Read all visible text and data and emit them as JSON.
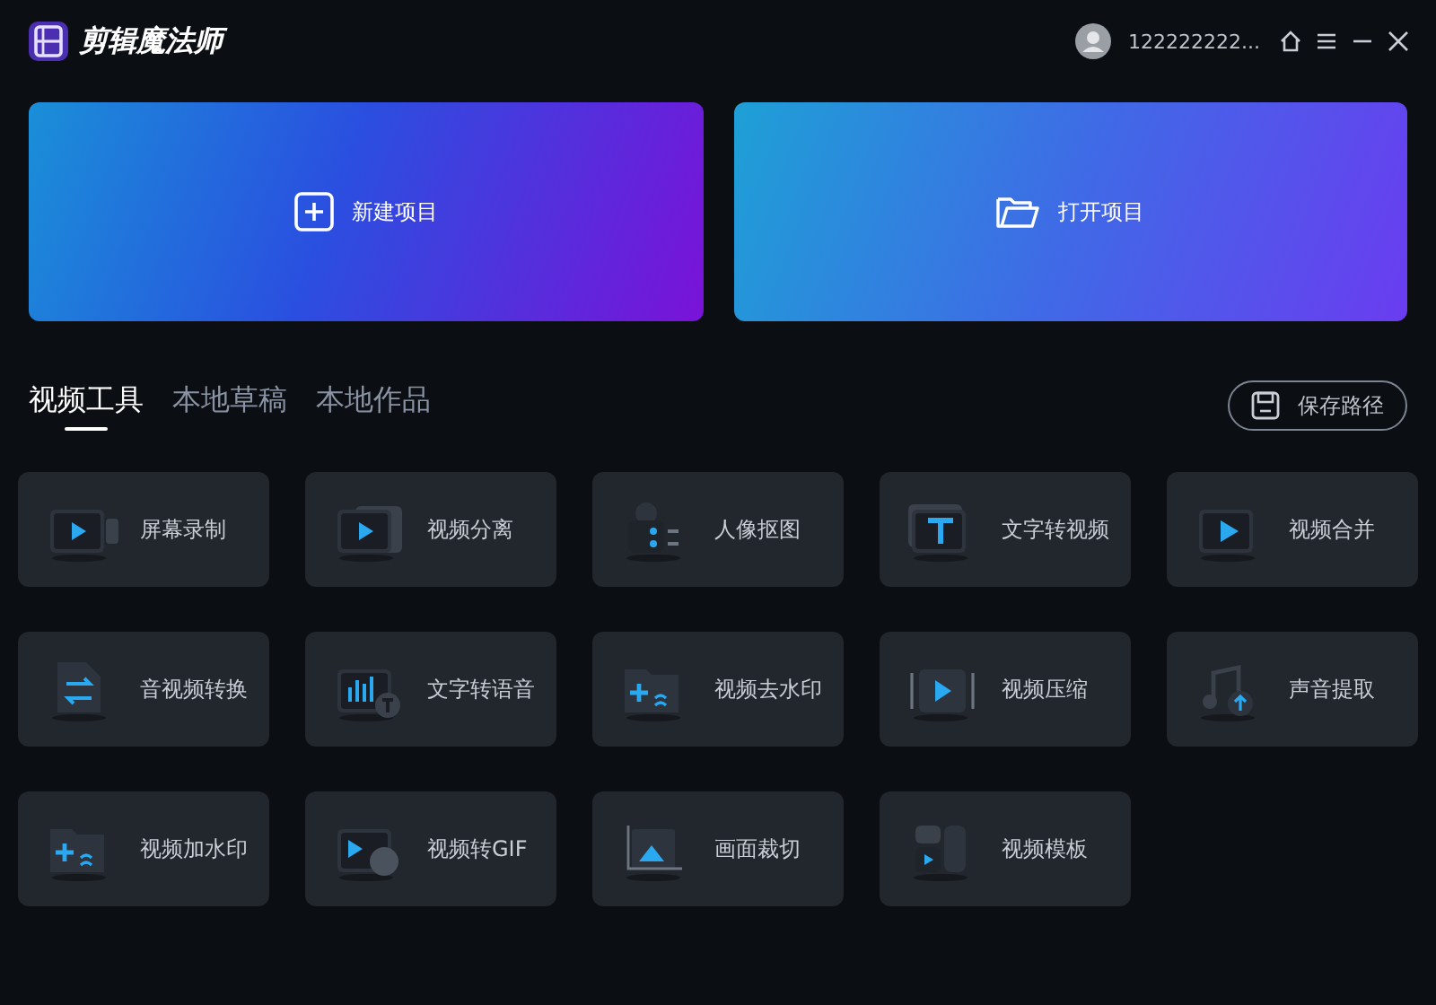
{
  "app": {
    "title": "剪辑魔法师"
  },
  "user": {
    "name": "122222222..."
  },
  "actions": [
    {
      "label": "新建项目",
      "kind": "new"
    },
    {
      "label": "打开项目",
      "kind": "open"
    }
  ],
  "tabs": [
    {
      "label": "视频工具",
      "selected": true
    },
    {
      "label": "本地草稿",
      "selected": false
    },
    {
      "label": "本地作品",
      "selected": false
    }
  ],
  "save_path_button": {
    "label": "保存路径"
  },
  "tools": [
    {
      "label": "屏幕录制"
    },
    {
      "label": "视频分离"
    },
    {
      "label": "人像抠图"
    },
    {
      "label": "文字转视频"
    },
    {
      "label": "视频合并"
    },
    {
      "label": "音视频转换"
    },
    {
      "label": "文字转语音"
    },
    {
      "label": "视频去水印"
    },
    {
      "label": "视频压缩"
    },
    {
      "label": "声音提取"
    },
    {
      "label": "视频加水印"
    },
    {
      "label": "视频转GIF"
    },
    {
      "label": "画面裁切"
    },
    {
      "label": "视频模板"
    }
  ]
}
